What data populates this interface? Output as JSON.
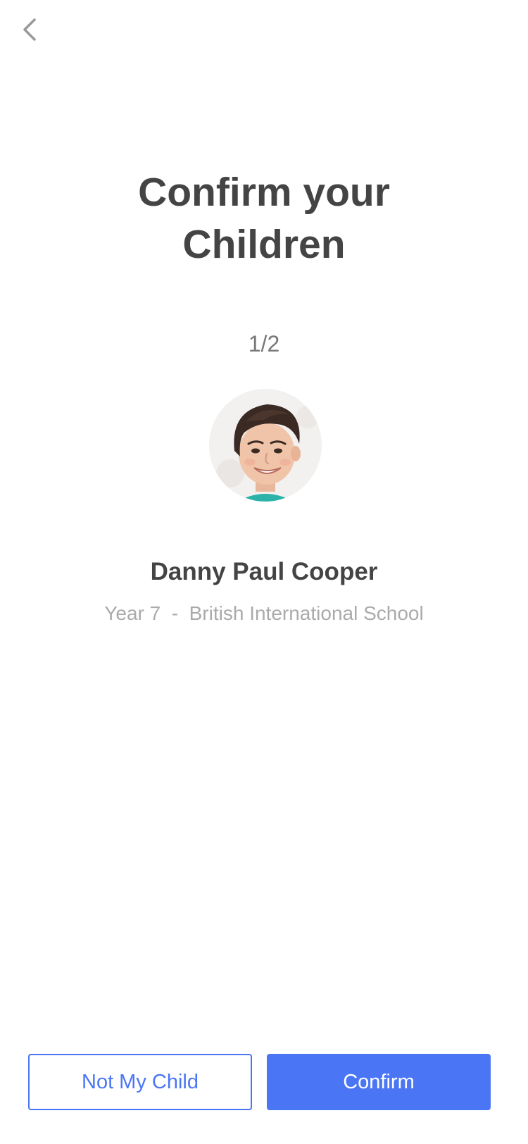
{
  "nav": {
    "back_icon": "chevron-left-icon"
  },
  "header": {
    "title_line1": "Confirm your",
    "title_line2": "Children"
  },
  "pager": {
    "counter": "1/2"
  },
  "child": {
    "avatar_icon": "child-photo",
    "name": "Danny Paul Cooper",
    "details": "Year 7  -  British International School"
  },
  "actions": {
    "reject_label": "Not My Child",
    "confirm_label": "Confirm"
  },
  "colors": {
    "accent": "#4a76f5",
    "title_text": "#444444",
    "muted_text": "#aaaaaa"
  }
}
